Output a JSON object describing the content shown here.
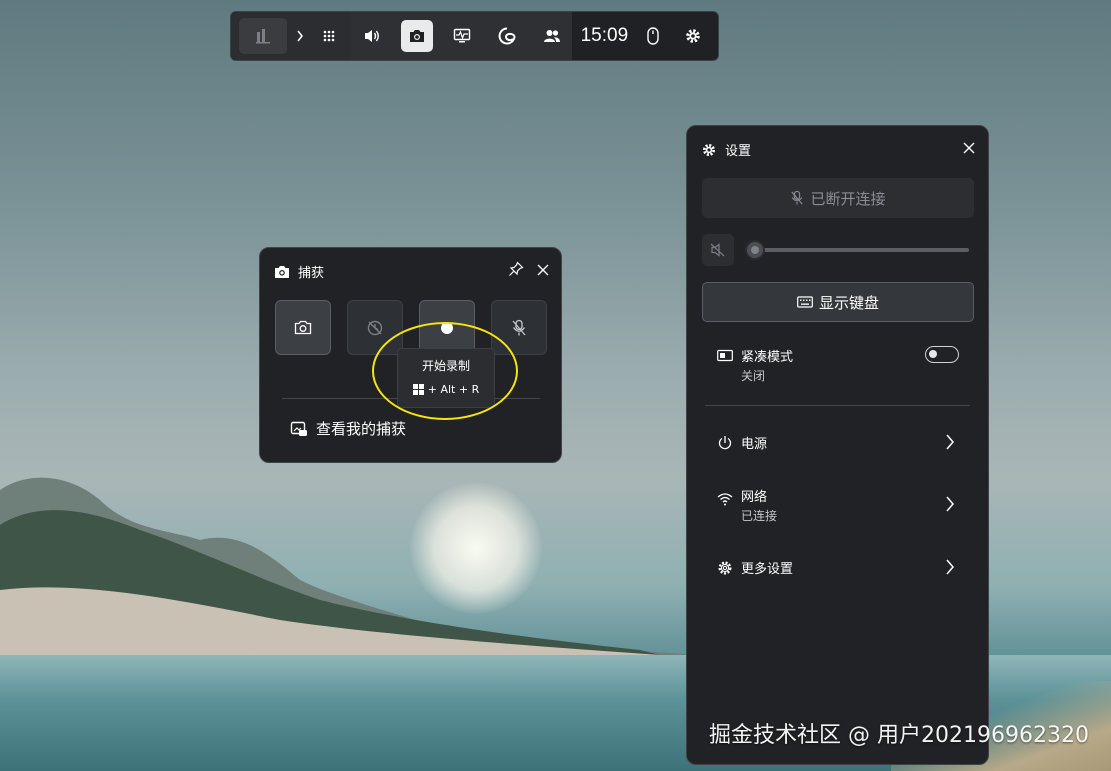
{
  "topbar": {
    "time": "15:09",
    "icons": [
      "game-logo-icon",
      "chevron-right-icon",
      "widget-menu-icon",
      "volume-icon",
      "camera-icon",
      "performance-icon",
      "edge-icon",
      "xbox-social-icon",
      "mouse-icon",
      "gear-icon"
    ],
    "active": "camera-icon"
  },
  "capture": {
    "title": "捕获",
    "tooltip_title": "开始录制",
    "tooltip_keys": "+ Alt + R",
    "gallery_label": "查看我的捕获"
  },
  "settings": {
    "title": "设置",
    "disconnected_label": "已断开连接",
    "volume_level": 0,
    "keyboard_label": "显示键盘",
    "compact_mode_label": "紧凑模式",
    "compact_mode_status": "关闭",
    "power_label": "电源",
    "network_label": "网络",
    "network_status": "已连接",
    "more_settings_label": "更多设置"
  },
  "watermark": "掘金技术社区 @ 用户202196962320",
  "colors": {
    "panel_bg": "#202225",
    "highlight_ring": "#f5e40f"
  }
}
